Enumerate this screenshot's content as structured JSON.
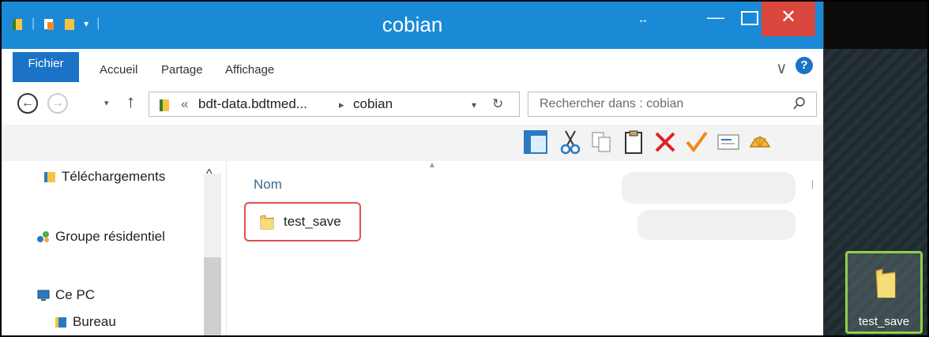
{
  "window": {
    "title": "cobian",
    "resize_glyph": "↔",
    "minimize_glyph": "—",
    "close_glyph": "✕"
  },
  "ribbon": {
    "tabs": [
      "Fichier",
      "Accueil",
      "Partage",
      "Affichage"
    ],
    "active_tab": "Fichier",
    "help_glyph": "?",
    "collapse_glyph": "∨"
  },
  "address": {
    "prefix": "«",
    "path": [
      "bdt-data.bdtmed...",
      "cobian"
    ],
    "separator": "▸",
    "search_placeholder": "Rechercher dans : cobian"
  },
  "navigation": {
    "back_glyph": "←",
    "forward_glyph": "→",
    "up_glyph": "↑",
    "dropdown_glyph": "▾"
  },
  "nav_pane": {
    "items": [
      {
        "label": "Téléchargements",
        "icon": "downloads-folder-icon"
      },
      {
        "label": "Groupe résidentiel",
        "icon": "homegroup-icon"
      },
      {
        "label": "Ce PC",
        "icon": "computer-icon"
      },
      {
        "label": "Bureau",
        "icon": "desktop-folder-icon"
      }
    ],
    "scroll_up_glyph": "^"
  },
  "content": {
    "column_header": "Nom",
    "files": [
      {
        "name": "test_save",
        "type": "folder",
        "highlight_color": "#e05050"
      }
    ]
  },
  "desktop": {
    "icons": [
      {
        "label": "test_save",
        "type": "folder",
        "highlight_color": "#8ed14b"
      }
    ]
  },
  "colors": {
    "title_bar": "#1b8ad6",
    "file_tab": "#1a73c6",
    "close_button": "#d9473f"
  }
}
